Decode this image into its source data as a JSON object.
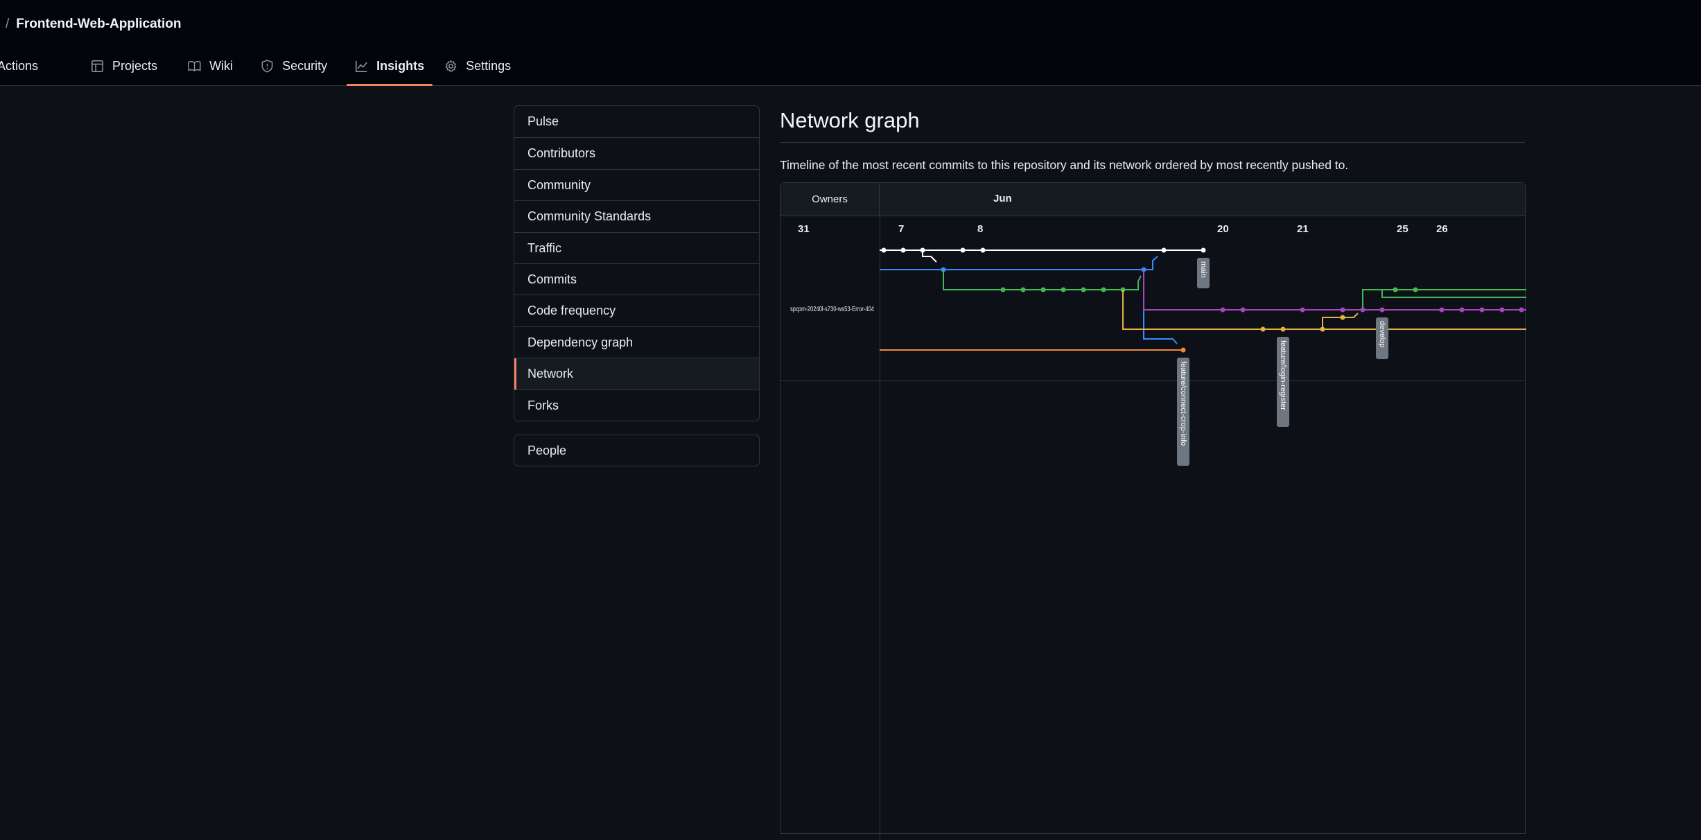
{
  "breadcrumb": {
    "separator": "/",
    "repo": "Frontend-Web-Application"
  },
  "tabs": [
    {
      "label": "Actions",
      "icon": "actions-icon"
    },
    {
      "label": "Projects",
      "icon": "table-icon"
    },
    {
      "label": "Wiki",
      "icon": "book-icon"
    },
    {
      "label": "Security",
      "icon": "shield-icon"
    },
    {
      "label": "Insights",
      "icon": "graph-icon",
      "active": true
    },
    {
      "label": "Settings",
      "icon": "gear-icon"
    }
  ],
  "menu": {
    "items": [
      {
        "label": "Pulse"
      },
      {
        "label": "Contributors"
      },
      {
        "label": "Community"
      },
      {
        "label": "Community Standards"
      },
      {
        "label": "Traffic"
      },
      {
        "label": "Commits"
      },
      {
        "label": "Code frequency"
      },
      {
        "label": "Dependency graph"
      },
      {
        "label": "Network",
        "selected": true
      },
      {
        "label": "Forks"
      }
    ],
    "people": "People"
  },
  "main": {
    "title": "Network graph",
    "description": "Timeline of the most recent commits to this repository and its network ordered by most recently pushed to."
  },
  "network": {
    "owners_header": "Owners",
    "month": "Jun",
    "owner": "spcpm-20240l-s730-ws53-Error-404",
    "days": [
      "31",
      "7",
      "8",
      "20",
      "21",
      "25",
      "26"
    ],
    "branches": [
      {
        "name": "main",
        "color": "#ffffff"
      },
      {
        "name": "feature/connect-crop-info",
        "color": "#f0883e"
      },
      {
        "name": "feature/login-register",
        "color": "#e3b341"
      },
      {
        "name": "develop",
        "color": "#a371f7"
      }
    ],
    "colors": {
      "white": "#ffffff",
      "blue": "#388bfd",
      "green": "#3fb950",
      "purple": "#a347ba",
      "yellow": "#e3b341",
      "orange": "#f0883e",
      "label_bg": "#6e7681"
    }
  }
}
